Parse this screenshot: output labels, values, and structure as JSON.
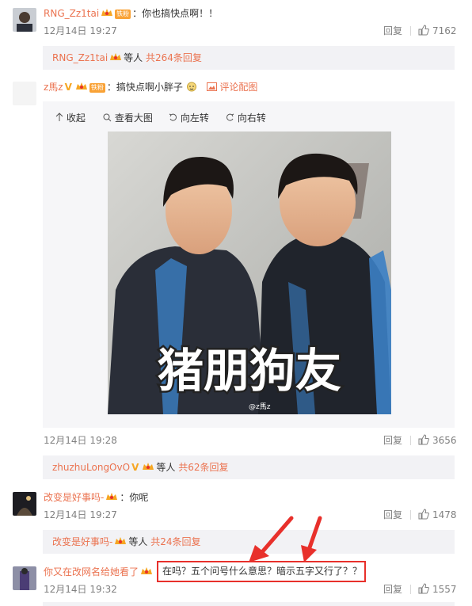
{
  "comments": [
    {
      "user": "RNG_Zz1tai",
      "fan_badge": "铁粉",
      "text": "：你也搞快点啊！！",
      "time": "12月14日 19:27",
      "reply_label": "回复",
      "likes": "7162",
      "sub": {
        "user": "RNG_Zz1tai",
        "others": "等人",
        "count": "共264条回复"
      }
    },
    {
      "user": "z馬z",
      "fan_badge": "铁粉",
      "text": "：搞快点啊小胖子",
      "image_link": "评论配图",
      "time": "12月14日 19:28",
      "reply_label": "回复",
      "likes": "3656",
      "image": {
        "caption": "猪朋狗友",
        "watermark": "@z馬z",
        "toolbar": [
          "收起",
          "查看大图",
          "向左转",
          "向右转"
        ]
      },
      "sub": {
        "user": "zhuzhuLongOvO",
        "others": "等人",
        "count": "共62条回复"
      }
    },
    {
      "user": "改变是好事吗-",
      "text": "：你呢",
      "time": "12月14日 19:27",
      "reply_label": "回复",
      "likes": "1478",
      "sub": {
        "user": "改变是好事吗-",
        "others": "等人",
        "count": "共24条回复"
      }
    },
    {
      "user": "你又在改网名给她看了",
      "highlight_text": "在吗？五个问号什么意思？暗示五字又行了？？",
      "time": "12月14日 19:32",
      "reply_label": "回复",
      "likes": "1557"
    }
  ],
  "colors": {
    "username": "#eb7350",
    "gray": "#808080",
    "subbox": "#f2f2f5",
    "highlight": "#e8302b"
  }
}
